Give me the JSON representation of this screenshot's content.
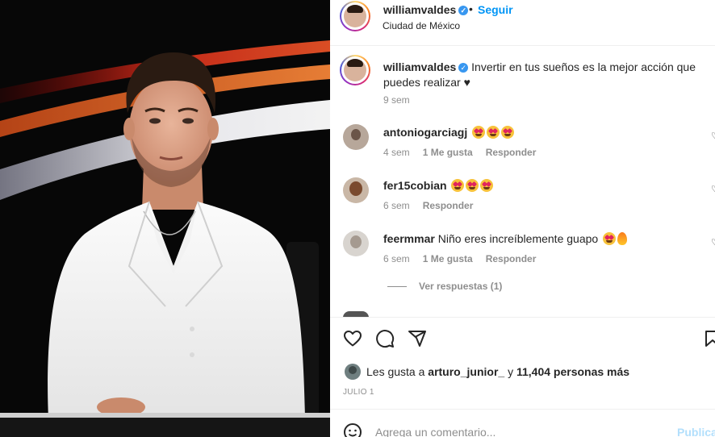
{
  "post": {
    "username": "williamvaldes",
    "dot": "•",
    "follow_label": "Seguir",
    "location": "Ciudad de México"
  },
  "caption": {
    "username": "williamvaldes",
    "text": "Invertir en tus sueños es la mejor acción que puedes realizar ♥",
    "time": "9 sem"
  },
  "comments": [
    {
      "username": "antoniogarciagj",
      "text": "",
      "time": "4 sem",
      "likes": "1 Me gusta",
      "reply": "Responder"
    },
    {
      "username": "fer15cobian",
      "text": "",
      "time": "6 sem",
      "likes": "",
      "reply": "Responder"
    },
    {
      "username": "feermmar",
      "text": "Niño eres increíblemente guapo",
      "time": "6 sem",
      "likes": "1 Me gusta",
      "reply": "Responder"
    }
  ],
  "view_replies": "Ver respuestas (1)",
  "likes": {
    "prefix": "Les gusta a",
    "user": "arturo_junior_",
    "connector": "y",
    "count": "11,404 personas más"
  },
  "date": "JULIO 1",
  "comment_input": {
    "placeholder": "Agrega un comentario...",
    "publish": "Publica"
  },
  "icons": [
    "verified-badge-icon",
    "heart-icon",
    "comment-icon",
    "share-icon",
    "bookmark-icon",
    "emoji-icon",
    "heart-eyes-emoji",
    "fire-emoji"
  ],
  "colors": {
    "link": "#0095f6",
    "muted": "#8e8e8e",
    "text": "#262626"
  }
}
